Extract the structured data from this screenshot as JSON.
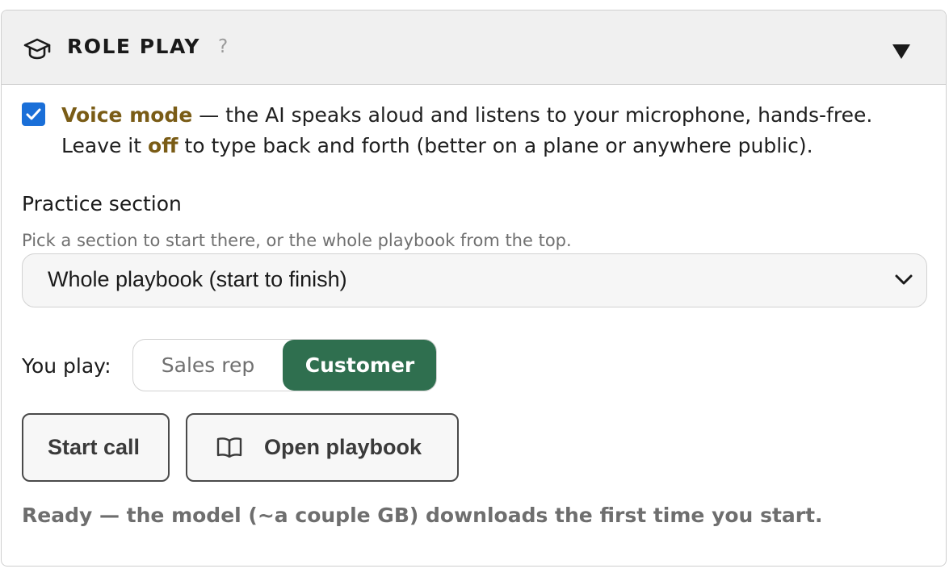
{
  "header": {
    "title": "ROLE PLAY",
    "help": "?",
    "icon": "graduation-cap-icon",
    "toggle_icon": "triangle-down-icon"
  },
  "voice": {
    "checked": true,
    "highlight_label": "Voice mode",
    "text_part1": " — the AI speaks aloud and listens to your microphone, hands-free. Leave it ",
    "highlight_off": "off",
    "text_part2": " to type back and forth (better on a plane or anywhere public)."
  },
  "practice": {
    "label": "Practice section",
    "hint": "Pick a section to start there, or the whole playbook from the top.",
    "selected": "Whole playbook (start to finish)"
  },
  "role": {
    "label": "You play:",
    "options": [
      "Sales rep",
      "Customer"
    ],
    "selected": "Customer"
  },
  "actions": {
    "start_call": "Start call",
    "open_playbook": "Open playbook",
    "open_playbook_icon": "book-open-icon"
  },
  "status": "Ready — the model (~a couple GB) downloads the first time you start.",
  "colors": {
    "accent_green": "#2f6f4f",
    "highlight_gold": "#7a5c16",
    "checkbox_blue": "#1a6fd8"
  }
}
